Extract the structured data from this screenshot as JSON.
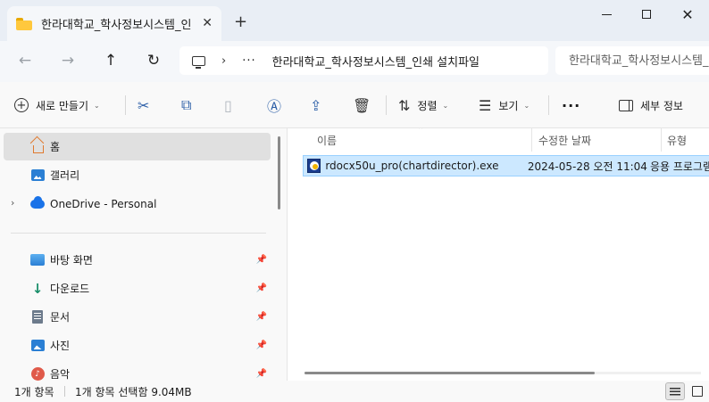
{
  "window": {
    "tab_title": "한라대학교_학사정보시스템_인",
    "tab_close": "✕",
    "new_tab": "+"
  },
  "navbar": {
    "back_icon": "←",
    "forward_icon": "→",
    "up_icon": "↑",
    "refresh_icon": "↻",
    "breadcrumb_separator": "›",
    "breadcrumb_more": "···",
    "breadcrumb_current": "한라대학교_학사정보시스템_인쇄 설치파일",
    "search_placeholder": "한라대학교_학사정보시스템_인쇄 설치파일 검색"
  },
  "toolbar": {
    "new_label": "새로 만들기",
    "sort_label": "정렬",
    "view_label": "보기",
    "more_label": "···",
    "details_label": "세부 정보",
    "chevron": "⌄"
  },
  "sidebar": {
    "items": [
      {
        "label": "홈",
        "icon": "home-icon"
      },
      {
        "label": "갤러리",
        "icon": "gallery-icon"
      },
      {
        "label": "OneDrive - Personal",
        "icon": "onedrive-cloud-icon"
      },
      {
        "label": "바탕 화면",
        "icon": "desktop-icon"
      },
      {
        "label": "다운로드",
        "icon": "download-icon"
      },
      {
        "label": "문서",
        "icon": "document-icon"
      },
      {
        "label": "사진",
        "icon": "pictures-icon"
      },
      {
        "label": "음악",
        "icon": "music-icon"
      }
    ],
    "expander": "›",
    "pin": "📌"
  },
  "content": {
    "columns": [
      "이름",
      "수정한 날짜",
      "유형"
    ],
    "sort_indicator": "⌃",
    "files": [
      {
        "name": "rdocx50u_pro(chartdirector).exe",
        "modified": "2024-05-28 오전 11:04",
        "type": "응용 프로그램"
      }
    ]
  },
  "status": {
    "item_count": "1개 항목",
    "selection": "1개 항목 선택함 9.04MB"
  },
  "colors": {
    "accent": "#2b5ea7",
    "selection_bg": "#cce8ff",
    "folder": "#ffc83d"
  }
}
